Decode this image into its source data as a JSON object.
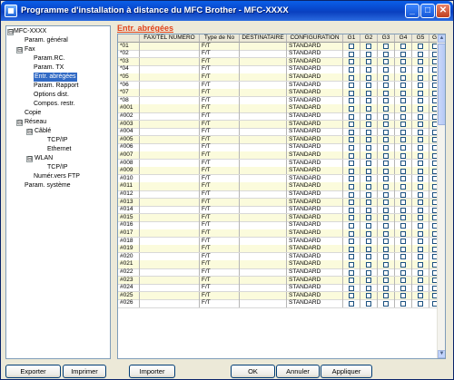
{
  "window": {
    "title": "Programme d'installation à distance du MFC Brother - MFC-XXXX",
    "minimize_glyph": "_",
    "maximize_glyph": "□",
    "close_glyph": "✕"
  },
  "tree": {
    "items": [
      {
        "label": "MFC-XXXX",
        "expander": "⊟",
        "selected": false
      },
      {
        "label": "Param. général",
        "selected": false
      },
      {
        "label": "Fax",
        "expander": "⊟",
        "selected": false
      },
      {
        "label": "Param.RC.",
        "selected": false
      },
      {
        "label": "Param. TX",
        "selected": false
      },
      {
        "label": "Entr. abrégées",
        "selected": true
      },
      {
        "label": "Param. Rapport",
        "selected": false
      },
      {
        "label": "Options dist.",
        "selected": false
      },
      {
        "label": "Compos. restr.",
        "selected": false
      },
      {
        "label": "Copie",
        "selected": false
      },
      {
        "label": "Réseau",
        "expander": "⊟",
        "selected": false
      },
      {
        "label": "Câblé",
        "expander": "⊟",
        "selected": false
      },
      {
        "label": "TCP/IP",
        "selected": false
      },
      {
        "label": "Ethernet",
        "selected": false
      },
      {
        "label": "WLAN",
        "expander": "⊟",
        "selected": false
      },
      {
        "label": "TCP/IP",
        "selected": false
      },
      {
        "label": "Numér.vers FTP",
        "selected": false
      },
      {
        "label": "Param. système",
        "selected": false
      }
    ]
  },
  "content": {
    "title": "Entr. abrégées",
    "columns": [
      "",
      "FAX/TEL NUMERO",
      "Type de No",
      "DESTINATAIRE",
      "CONFIGURATION",
      "G1",
      "G2",
      "G3",
      "G4",
      "G5",
      "G"
    ],
    "rows": [
      {
        "id": "*01",
        "type": "F/T",
        "dest": "",
        "config": "STANDARD"
      },
      {
        "id": "*02",
        "type": "F/T",
        "dest": "",
        "config": "STANDARD"
      },
      {
        "id": "*03",
        "type": "F/T",
        "dest": "",
        "config": "STANDARD"
      },
      {
        "id": "*04",
        "type": "F/T",
        "dest": "",
        "config": "STANDARD"
      },
      {
        "id": "*05",
        "type": "F/T",
        "dest": "",
        "config": "STANDARD"
      },
      {
        "id": "*06",
        "type": "F/T",
        "dest": "",
        "config": "STANDARD"
      },
      {
        "id": "*07",
        "type": "F/T",
        "dest": "",
        "config": "STANDARD"
      },
      {
        "id": "*08",
        "type": "F/T",
        "dest": "",
        "config": "STANDARD"
      },
      {
        "id": "#001",
        "type": "F/T",
        "dest": "",
        "config": "STANDARD"
      },
      {
        "id": "#002",
        "type": "F/T",
        "dest": "",
        "config": "STANDARD"
      },
      {
        "id": "#003",
        "type": "F/T",
        "dest": "",
        "config": "STANDARD"
      },
      {
        "id": "#004",
        "type": "F/T",
        "dest": "",
        "config": "STANDARD"
      },
      {
        "id": "#005",
        "type": "F/T",
        "dest": "",
        "config": "STANDARD"
      },
      {
        "id": "#006",
        "type": "F/T",
        "dest": "",
        "config": "STANDARD"
      },
      {
        "id": "#007",
        "type": "F/T",
        "dest": "",
        "config": "STANDARD"
      },
      {
        "id": "#008",
        "type": "F/T",
        "dest": "",
        "config": "STANDARD"
      },
      {
        "id": "#009",
        "type": "F/T",
        "dest": "",
        "config": "STANDARD"
      },
      {
        "id": "#010",
        "type": "F/T",
        "dest": "",
        "config": "STANDARD"
      },
      {
        "id": "#011",
        "type": "F/T",
        "dest": "",
        "config": "STANDARD"
      },
      {
        "id": "#012",
        "type": "F/T",
        "dest": "",
        "config": "STANDARD"
      },
      {
        "id": "#013",
        "type": "F/T",
        "dest": "",
        "config": "STANDARD"
      },
      {
        "id": "#014",
        "type": "F/T",
        "dest": "",
        "config": "STANDARD"
      },
      {
        "id": "#015",
        "type": "F/T",
        "dest": "",
        "config": "STANDARD"
      },
      {
        "id": "#016",
        "type": "F/T",
        "dest": "",
        "config": "STANDARD"
      },
      {
        "id": "#017",
        "type": "F/T",
        "dest": "",
        "config": "STANDARD"
      },
      {
        "id": "#018",
        "type": "F/T",
        "dest": "",
        "config": "STANDARD"
      },
      {
        "id": "#019",
        "type": "F/T",
        "dest": "",
        "config": "STANDARD"
      },
      {
        "id": "#020",
        "type": "F/T",
        "dest": "",
        "config": "STANDARD"
      },
      {
        "id": "#021",
        "type": "F/T",
        "dest": "",
        "config": "STANDARD"
      },
      {
        "id": "#022",
        "type": "F/T",
        "dest": "",
        "config": "STANDARD"
      },
      {
        "id": "#023",
        "type": "F/T",
        "dest": "",
        "config": "STANDARD"
      },
      {
        "id": "#024",
        "type": "F/T",
        "dest": "",
        "config": "STANDARD"
      },
      {
        "id": "#025",
        "type": "F/T",
        "dest": "",
        "config": "STANDARD"
      },
      {
        "id": "#026",
        "type": "F/T",
        "dest": "",
        "config": "STANDARD"
      }
    ]
  },
  "scrollbar": {
    "up_glyph": "▲",
    "down_glyph": "▼"
  },
  "buttons": {
    "export": "Exporter",
    "print": "Imprimer",
    "import": "Importer",
    "ok": "OK",
    "cancel": "Annuler",
    "apply": "Appliquer"
  },
  "colors": {
    "selection": "#316ac5",
    "section_title": "#e0441c",
    "row_alt": "#fbfbdc",
    "titlebar": "#0845c9"
  }
}
